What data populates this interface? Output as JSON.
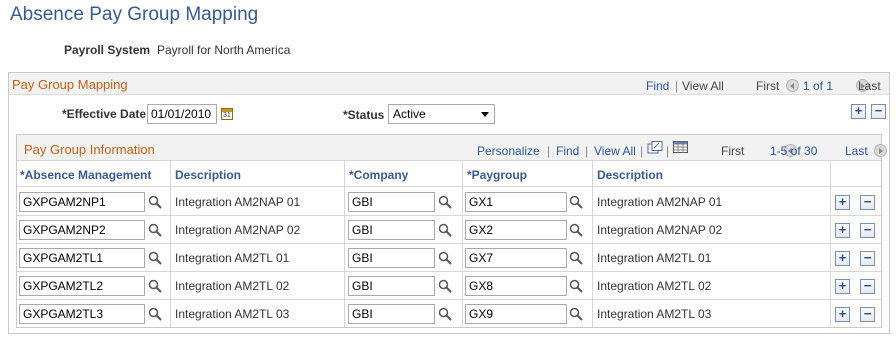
{
  "page": {
    "title": "Absence Pay Group Mapping"
  },
  "payroll_system": {
    "label": "Payroll System",
    "value": "Payroll for North America"
  },
  "mapping_section": {
    "title": "Pay Group Mapping",
    "find": "Find",
    "view_all": "View All",
    "first": "First",
    "count": "1 of 1",
    "last": "Last",
    "effective_date_label": "*Effective Date",
    "effective_date_value": "01/01/2010",
    "status_label": "*Status",
    "status_value": "Active"
  },
  "grid": {
    "title": "Pay Group Information",
    "personalize": "Personalize",
    "find": "Find",
    "view_all": "View All",
    "first": "First",
    "count": "1-5 of 30",
    "last": "Last",
    "columns": [
      "*Absence Management",
      "Description",
      "*Company",
      "*Paygroup",
      "Description"
    ],
    "rows": [
      {
        "absence": "GXPGAM2NP1",
        "desc1": "Integration AM2NAP 01",
        "company": "GBI",
        "paygroup": "GX1",
        "desc2": "Integration AM2NAP 01"
      },
      {
        "absence": "GXPGAM2NP2",
        "desc1": "Integration AM2NAP 02",
        "company": "GBI",
        "paygroup": "GX2",
        "desc2": "Integration AM2NAP 02"
      },
      {
        "absence": "GXPGAM2TL1",
        "desc1": "Integration AM2TL 01",
        "company": "GBI",
        "paygroup": "GX7",
        "desc2": "Integration AM2TL 01"
      },
      {
        "absence": "GXPGAM2TL2",
        "desc1": "Integration AM2TL 02",
        "company": "GBI",
        "paygroup": "GX8",
        "desc2": "Integration AM2TL 02"
      },
      {
        "absence": "GXPGAM2TL3",
        "desc1": "Integration AM2TL 03",
        "company": "GBI",
        "paygroup": "GX9",
        "desc2": "Integration AM2TL 03"
      }
    ]
  },
  "icons": {
    "calendar": "calendar-icon",
    "lookup": "magnifier-lookup-icon",
    "add": "+",
    "delete": "−",
    "calendar_day": "31"
  },
  "colors": {
    "title": "#3a5a8c",
    "section_title": "#c0601c",
    "link": "#2b5797"
  }
}
